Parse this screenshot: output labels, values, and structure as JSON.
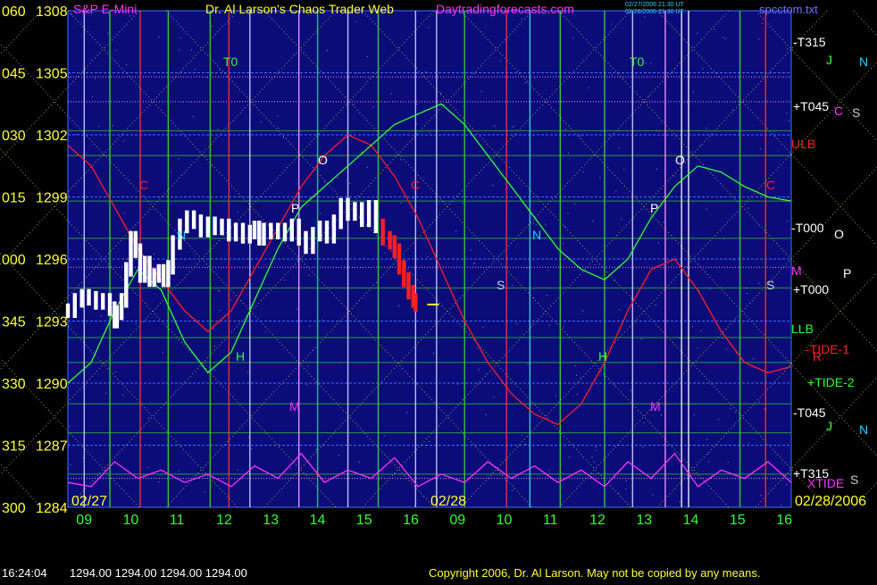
{
  "header": {
    "title_left": "S&P E-Mini",
    "title_center": "Dr. Al Larson's Chaos Trader Web",
    "title_site": "Daytradingforecasts.com",
    "title_file": "spcctom.txt",
    "timestamp_1": "02/27/2006 21:30 UT",
    "timestamp_2": "02/28/2006 21:30 UT"
  },
  "footer": {
    "time": "16:24:04",
    "ohlc": "1294.00 1294.00 1294.00 1294.00",
    "copyright": "Copyright 2006, Dr. Al Larson. May not be copied by any means."
  },
  "colors": {
    "plot_bg": "#0b0b7a",
    "frame": "#3f6fff",
    "axis_text": "#ffff33",
    "time_labels": "#33ff33",
    "tide": "#ff2020",
    "xtide": "#ff33ff",
    "bands": "#33dd33",
    "price_bars": "#ffffff"
  },
  "chart_data": {
    "type": "line",
    "title": "Dr. Al Larson's Chaos Trader Web",
    "y_axis": {
      "range": [
        1284,
        1308
      ],
      "price_ticks": [
        "1308",
        "1305",
        "1302",
        "1299",
        "1296",
        "1293",
        "1290",
        "1287",
        "1284"
      ],
      "angle_ticks": [
        "060",
        "045",
        "030",
        "015",
        "000",
        "345",
        "330",
        "315",
        "300"
      ]
    },
    "x_axis": {
      "ticks": [
        "09",
        "10",
        "11",
        "12",
        "13",
        "14",
        "15",
        "16",
        "09",
        "10",
        "11",
        "12",
        "13",
        "14",
        "15",
        "16"
      ],
      "date_labels": [
        "02/27",
        "02/28",
        "02/28/2006"
      ]
    },
    "right_labels": [
      {
        "text": "-T315",
        "color": "#ffffff"
      },
      {
        "text": "J",
        "color": "#33ff33"
      },
      {
        "text": "N",
        "color": "#33ccff"
      },
      {
        "text": "+T045",
        "color": "#ffffff"
      },
      {
        "text": "C",
        "color": "#ff33ff"
      },
      {
        "text": "S",
        "color": "#cccccc"
      },
      {
        "text": "ULB",
        "color": "#ff2020"
      },
      {
        "text": "-T000",
        "color": "#ffffff"
      },
      {
        "text": "O",
        "color": "#ffffff"
      },
      {
        "text": "M",
        "color": "#ff33ff"
      },
      {
        "text": "P",
        "color": "#ffffff"
      },
      {
        "text": "+T000",
        "color": "#ffffff"
      },
      {
        "text": "LLB",
        "color": "#33ff33"
      },
      {
        "text": "-TIDE-1",
        "color": "#ff2020"
      },
      {
        "text": "+TIDE-2",
        "color": "#33ff33"
      },
      {
        "text": "-T045",
        "color": "#ffffff"
      },
      {
        "text": "J",
        "color": "#33ff33"
      },
      {
        "text": "N",
        "color": "#33ccff"
      },
      {
        "text": "+T315",
        "color": "#ffffff"
      },
      {
        "text": "XTIDE",
        "color": "#ff33ff"
      },
      {
        "text": "S",
        "color": "#cccccc"
      }
    ],
    "in_chart_labels": [
      {
        "text": "T0",
        "color": "#33ff33"
      },
      {
        "text": "T0",
        "color": "#33ff33"
      },
      {
        "text": "N",
        "color": "#33ccff"
      },
      {
        "text": "N",
        "color": "#33ccff"
      },
      {
        "text": "O",
        "color": "#ffffff"
      },
      {
        "text": "O",
        "color": "#ffffff"
      },
      {
        "text": "P",
        "color": "#ffffff"
      },
      {
        "text": "P",
        "color": "#ffffff"
      },
      {
        "text": "C",
        "color": "#ff2020"
      },
      {
        "text": "C",
        "color": "#ff2020"
      },
      {
        "text": "C",
        "color": "#ff2020"
      },
      {
        "text": "H",
        "color": "#33ff33"
      },
      {
        "text": "H",
        "color": "#33ff33"
      },
      {
        "text": "M",
        "color": "#ff33ff"
      },
      {
        "text": "M",
        "color": "#ff33ff"
      },
      {
        "text": "S",
        "color": "#cccccc"
      },
      {
        "text": "S",
        "color": "#cccccc"
      },
      {
        "text": "R",
        "color": "#ff2020"
      }
    ],
    "series": [
      {
        "name": "S&P E-Mini",
        "color": "#ffffff",
        "x": [
          0.0,
          0.15,
          0.3,
          0.45,
          0.6,
          0.75,
          0.9,
          1.0,
          1.05,
          1.15,
          1.25,
          1.35,
          1.45,
          1.55,
          1.65,
          1.75,
          1.85,
          1.95,
          2.05,
          2.15,
          2.25,
          2.4,
          2.55,
          2.7,
          2.85,
          3.0,
          3.15,
          3.3,
          3.45,
          3.6,
          3.75,
          3.9,
          4.0,
          4.1,
          4.2,
          4.35,
          4.5,
          4.65,
          4.8,
          4.95,
          5.1,
          5.25,
          5.4,
          5.55,
          5.7,
          5.85,
          6.0,
          6.15,
          6.3,
          6.45,
          6.6,
          6.75,
          6.9,
          7.0,
          7.1,
          7.2,
          7.3,
          7.4,
          7.45
        ],
        "values": [
          1293.5,
          1294.0,
          1294.2,
          1294.1,
          1293.9,
          1294.0,
          1293.6,
          1293.0,
          1293.4,
          1294.0,
          1295.5,
          1297.0,
          1296.4,
          1295.2,
          1295.8,
          1295.0,
          1295.2,
          1295.4,
          1295.0,
          1295.6,
          1296.8,
          1297.6,
          1298.0,
          1297.8,
          1297.4,
          1297.7,
          1297.5,
          1297.6,
          1297.2,
          1297.4,
          1297.1,
          1297.3,
          1297.5,
          1297.0,
          1297.4,
          1297.3,
          1297.4,
          1297.2,
          1297.6,
          1297.0,
          1296.6,
          1297.2,
          1297.5,
          1297.1,
          1297.8,
          1298.6,
          1298.2,
          1298.4,
          1297.9,
          1298.5,
          1297.6,
          1297.0,
          1296.8,
          1296.4,
          1295.6,
          1295.0,
          1294.4,
          1294.0,
          1293.8
        ]
      },
      {
        "name": "-TIDE-1",
        "color": "#ff2020",
        "x": [
          0,
          0.5,
          1.0,
          1.5,
          2.0,
          2.5,
          3.0,
          3.5,
          4.0,
          4.5,
          5.0,
          5.5,
          6.0,
          6.5,
          7.0,
          7.5,
          8.0,
          8.5,
          9.0,
          9.5,
          10.0,
          10.5,
          11.0,
          11.5,
          12.0,
          12.5,
          13.0,
          13.5,
          14.0,
          14.5,
          15.0,
          15.5
        ],
        "values": [
          1301.5,
          1300.5,
          1298.5,
          1296.5,
          1295.0,
          1293.5,
          1292.5,
          1293.5,
          1295.5,
          1297.5,
          1299.5,
          1301.0,
          1302.0,
          1301.5,
          1300.0,
          1298.0,
          1295.5,
          1293.0,
          1291.0,
          1289.5,
          1288.5,
          1288.0,
          1289.0,
          1291.0,
          1293.5,
          1295.5,
          1296.0,
          1294.5,
          1292.5,
          1291.0,
          1290.5,
          1290.8
        ]
      },
      {
        "name": "+TIDE-2",
        "color": "#33ff33",
        "x": [
          0,
          0.5,
          1.0,
          1.5,
          2.0,
          2.5,
          3.0,
          3.5,
          4.0,
          4.5,
          5.0,
          5.5,
          6.0,
          6.5,
          7.0,
          7.5,
          8.0,
          8.5,
          9.0,
          9.5,
          10.0,
          10.5,
          11.0,
          11.5,
          12.0,
          12.5,
          13.0,
          13.5,
          14.0,
          14.5,
          15.0,
          15.5
        ],
        "values": [
          1290.0,
          1291.0,
          1293.5,
          1295.5,
          1294.5,
          1292.0,
          1290.5,
          1291.5,
          1294.0,
          1296.5,
          1298.5,
          1299.5,
          1300.5,
          1301.5,
          1302.5,
          1303.0,
          1303.5,
          1302.5,
          1301.0,
          1299.5,
          1298.0,
          1296.5,
          1295.5,
          1295.0,
          1296.0,
          1298.0,
          1299.5,
          1300.5,
          1300.2,
          1299.5,
          1299.0,
          1298.8
        ]
      },
      {
        "name": "XTIDE",
        "color": "#ff33ff",
        "x": [
          0,
          0.5,
          1.0,
          1.5,
          2.0,
          2.5,
          3.0,
          3.5,
          4.0,
          4.5,
          5.0,
          5.5,
          6.0,
          6.5,
          7.0,
          7.5,
          8.0,
          8.5,
          9.0,
          9.5,
          10.0,
          10.5,
          11.0,
          11.5,
          12.0,
          12.5,
          13.0,
          13.5,
          14.0,
          14.5,
          15.0,
          15.5
        ],
        "values": [
          1285.2,
          1285.0,
          1286.2,
          1285.4,
          1285.8,
          1285.2,
          1285.6,
          1285.0,
          1286.0,
          1285.4,
          1286.6,
          1285.2,
          1285.8,
          1285.4,
          1286.4,
          1285.0,
          1285.6,
          1285.2,
          1286.2,
          1285.4,
          1286.0,
          1285.2,
          1285.8,
          1285.0,
          1286.2,
          1285.4,
          1286.6,
          1285.0,
          1285.8,
          1285.4,
          1286.2,
          1285.2
        ]
      }
    ],
    "grid": true,
    "legend": "none"
  }
}
